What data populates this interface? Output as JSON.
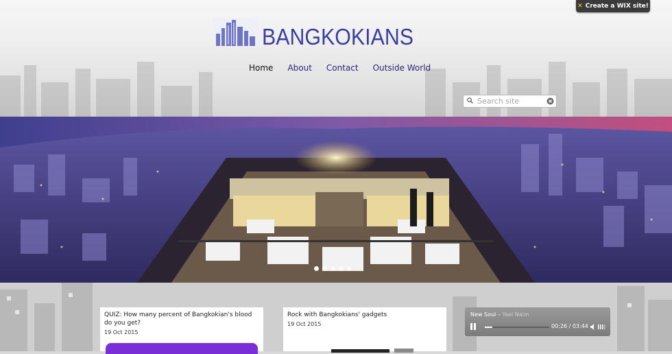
{
  "wix_badge": {
    "label": "Create a WIX site!"
  },
  "site": {
    "title": "BANGKOKIANS"
  },
  "nav": {
    "items": [
      "Home",
      "About",
      "Contact",
      "Outside World"
    ]
  },
  "search": {
    "placeholder": "Search site"
  },
  "slideshow": {
    "slide_count": 5,
    "current": 1
  },
  "posts": [
    {
      "title": "QUIZ: How many percent of Bangkokian's blood do you get?",
      "date": "19 Oct 2015"
    },
    {
      "title": "Rock with Bangkokians' gadgets",
      "date": "19 Oct 2015"
    }
  ],
  "player": {
    "song": "New Soul",
    "artist": "Yael Naim",
    "current_time": "00:26",
    "total_time": "03:44",
    "progress": 0.12
  },
  "colors": {
    "brand": "#3c3e9e",
    "nav": "#272a7a",
    "quiz_button": "#7a2fd6",
    "wix_x": "#f5d327"
  }
}
